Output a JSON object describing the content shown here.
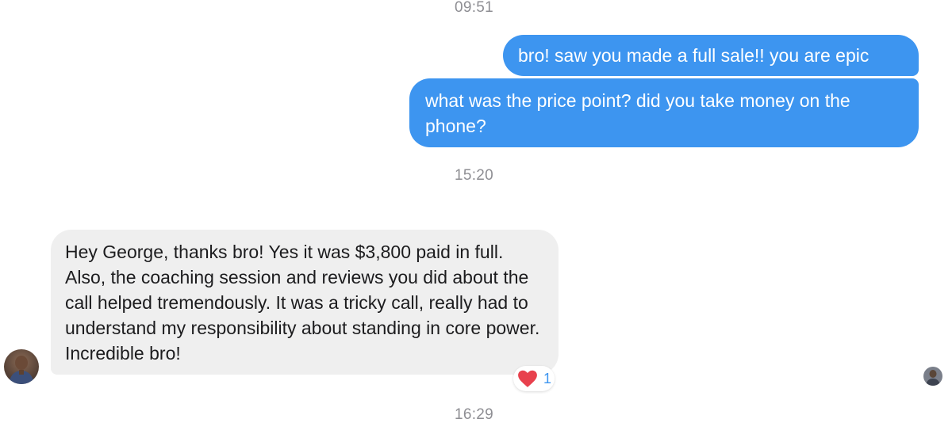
{
  "thread": {
    "timestamps": [
      "09:51",
      "15:20",
      "16:29"
    ],
    "outgoing": [
      "bro! saw you made a full sale!! you are epic",
      "what was the price point? did you take money on the phone?"
    ],
    "incoming": [
      {
        "text": "Hey George, thanks bro! Yes it was $3,800 paid in full. Also, the coaching session and reviews you did about the call helped tremendously. It was a tricky call, really had to understand my responsibility about standing in core power. Incredible bro!",
        "reaction": {
          "icon": "heart-icon",
          "count": "1"
        }
      }
    ]
  },
  "colors": {
    "outgoing_bubble": "#3d95f0",
    "incoming_bubble": "#efefef",
    "reaction_heart": "#e8414d",
    "reaction_count": "#3d95f0",
    "timestamp": "#8e8e93"
  }
}
